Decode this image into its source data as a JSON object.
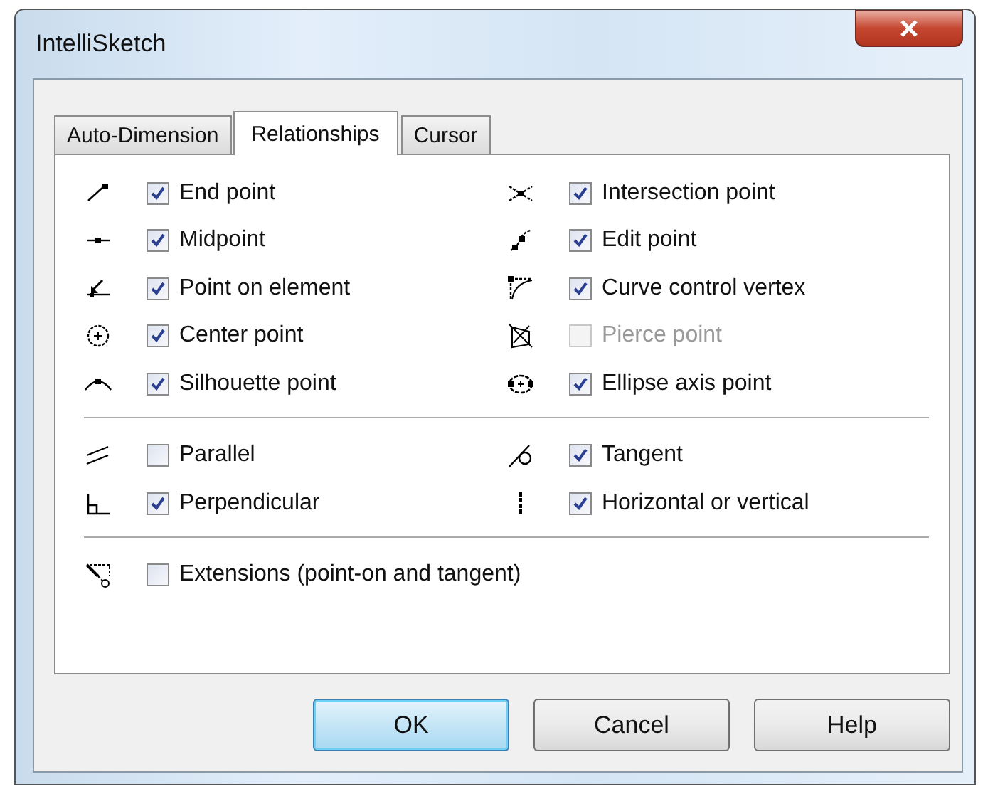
{
  "window": {
    "title": "IntelliSketch"
  },
  "tabs": [
    {
      "label": "Auto-Dimension",
      "selected": false
    },
    {
      "label": "Relationships",
      "selected": true
    },
    {
      "label": "Cursor",
      "selected": false
    }
  ],
  "sections": [
    {
      "columns": [
        [
          {
            "label": "End point",
            "checked": true,
            "disabled": false
          },
          {
            "label": "Midpoint",
            "checked": true,
            "disabled": false
          },
          {
            "label": "Point on element",
            "checked": true,
            "disabled": false
          },
          {
            "label": "Center point",
            "checked": true,
            "disabled": false
          },
          {
            "label": "Silhouette point",
            "checked": true,
            "disabled": false
          }
        ],
        [
          {
            "label": "Intersection point",
            "checked": true,
            "disabled": false
          },
          {
            "label": "Edit point",
            "checked": true,
            "disabled": false
          },
          {
            "label": "Curve control vertex",
            "checked": true,
            "disabled": false
          },
          {
            "label": "Pierce point",
            "checked": false,
            "disabled": true
          },
          {
            "label": "Ellipse axis point",
            "checked": true,
            "disabled": false
          }
        ]
      ]
    },
    {
      "columns": [
        [
          {
            "label": "Parallel",
            "checked": false,
            "disabled": false
          },
          {
            "label": "Perpendicular",
            "checked": true,
            "disabled": false
          }
        ],
        [
          {
            "label": "Tangent",
            "checked": true,
            "disabled": false
          },
          {
            "label": "Horizontal or vertical",
            "checked": true,
            "disabled": false
          }
        ]
      ]
    },
    {
      "columns": [
        [
          {
            "label": "Extensions (point-on and tangent)",
            "checked": false,
            "disabled": false
          }
        ]
      ]
    }
  ],
  "buttons": [
    {
      "label": "OK",
      "default": true
    },
    {
      "label": "Cancel",
      "default": false
    },
    {
      "label": "Help",
      "default": false
    }
  ]
}
